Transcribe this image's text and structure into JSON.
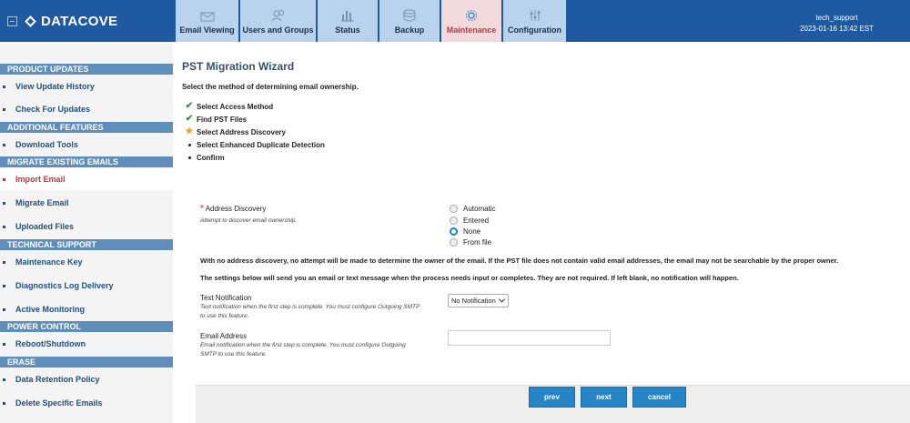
{
  "app": {
    "brand": "DATACOVE"
  },
  "user": {
    "name": "tech_support",
    "datetime": "2023-01-16 13:42 EST"
  },
  "nav": {
    "tabs": [
      {
        "label": "Email Viewing",
        "icon": "envelope-icon"
      },
      {
        "label": "Users and Groups",
        "icon": "users-icon"
      },
      {
        "label": "Status",
        "icon": "bar-chart-icon"
      },
      {
        "label": "Backup",
        "icon": "database-icon"
      },
      {
        "label": "Maintenance",
        "icon": "gear-icon",
        "active": true
      },
      {
        "label": "Configuration",
        "icon": "sliders-icon"
      }
    ]
  },
  "sidebar": {
    "sections": [
      "PRODUCT UPDATES",
      "ADDITIONAL FEATURES",
      "MIGRATE EXISTING EMAILS",
      "TECHNICAL SUPPORT",
      "POWER CONTROL",
      "ERASE"
    ],
    "items": [
      "View Update History",
      "Check For Updates",
      "Download Tools",
      "Import Email",
      "Migrate Email",
      "Uploaded Files",
      "Maintenance Key",
      "Diagnostics Log Delivery",
      "Active Monitoring",
      "Reboot/Shutdown",
      "Data Retention Policy",
      "Delete Specific Emails"
    ],
    "active_item": "Import Email"
  },
  "page": {
    "title": "PST Migration Wizard",
    "subtitle": "Select the method of determining email ownership.",
    "steps": [
      {
        "label": "Select Access Method",
        "status": "done"
      },
      {
        "label": "Find PST Files",
        "status": "done"
      },
      {
        "label": "Select Address Discovery",
        "status": "current"
      },
      {
        "label": "Select Enhanced Duplicate Detection",
        "status": "pending"
      },
      {
        "label": "Confirm",
        "status": "pending"
      }
    ]
  },
  "form": {
    "address_discovery": {
      "label": "Address Discovery",
      "description": "Attempt to discover email ownership.",
      "options": [
        "Automatic",
        "Entered",
        "None",
        "From file"
      ],
      "selected": "None"
    },
    "note1": "With no address discovery, no attempt will be made to determine the owner of the email. If the PST file does not contain valid email addresses, the email may not be searchable by the proper owner.",
    "note2": "The settings below will send you an email or text message when the process needs input or completes. They are not required. If left blank, no notification will happen.",
    "text_notification": {
      "label": "Text Notification",
      "description_line1": "Text notification when the first step is complete. You must configure Outgoing SMTP",
      "description_line2": "to use this feature.",
      "selected": "No Notification"
    },
    "email_address": {
      "label": "Email Address",
      "description_line1": "Email notification when the first step is complete. You must configure Outgoing",
      "description_line2": "SMTP to use this feature.",
      "value": ""
    }
  },
  "buttons": {
    "prev": "prev",
    "next": "next",
    "cancel": "cancel"
  },
  "colors": {
    "header": "#1f5aa0",
    "accent": "#2585c7",
    "active": "#c03646"
  }
}
